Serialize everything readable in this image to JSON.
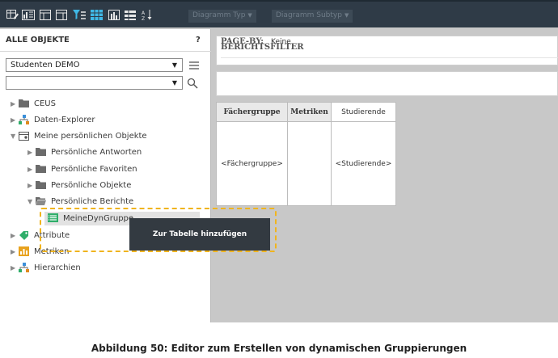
{
  "toolbar": {
    "icons": [
      "grid-edit-icon",
      "table-graph-icon",
      "layout-icon",
      "layout-alt-icon",
      "filter-icon",
      "table-view-icon",
      "bar-chart-icon",
      "stacked-chart-icon",
      "sort-az-icon"
    ],
    "diagram_type_label": "Diagramm Typ",
    "diagram_subtype_label": "Diagramm Subtyp"
  },
  "left_panel": {
    "title": "ALLE OBJEKTE",
    "help": "?",
    "project_select": "Studenten DEMO",
    "search_value": "",
    "tree": [
      {
        "label": "CEUS",
        "icon": "folder-icon"
      },
      {
        "label": "Daten-Explorer",
        "icon": "explorer-icon"
      },
      {
        "label": "Meine persönlichen Objekte",
        "icon": "personal-objects-icon"
      },
      {
        "label": "Persönliche Antworten",
        "icon": "folder-icon"
      },
      {
        "label": "Persönliche Favoriten",
        "icon": "folder-icon"
      },
      {
        "label": "Persönliche Objekte",
        "icon": "folder-icon"
      },
      {
        "label": "Persönliche Berichte",
        "icon": "folder-open-icon"
      },
      {
        "label": "MeineDynGruppe",
        "icon": "dyn-group-icon"
      },
      {
        "label": "Attribute",
        "icon": "attribute-icon"
      },
      {
        "label": "Metriken",
        "icon": "metric-icon"
      },
      {
        "label": "Hierarchien",
        "icon": "hierarchy-icon"
      }
    ]
  },
  "tooltip": {
    "label": "Zur Tabelle hinzufügen"
  },
  "colors": {
    "toolbar_bg": "#2f3b47",
    "highlight": "#f0b41e",
    "tooltip_bg": "#333a41",
    "accent_green": "#2fae6a"
  },
  "right_panel": {
    "filter_title": "BERICHTSFILTER",
    "pageby_label": "PAGE-BY:",
    "pageby_value": "Keine",
    "grid": {
      "headers": [
        "Fächergruppe",
        "Metriken",
        "Studierende"
      ],
      "cells": [
        "<Fächergruppe>",
        "",
        "<Studierende>"
      ]
    }
  },
  "caption": "Abbildung 50: Editor zum Erstellen von dynamischen Gruppierungen"
}
